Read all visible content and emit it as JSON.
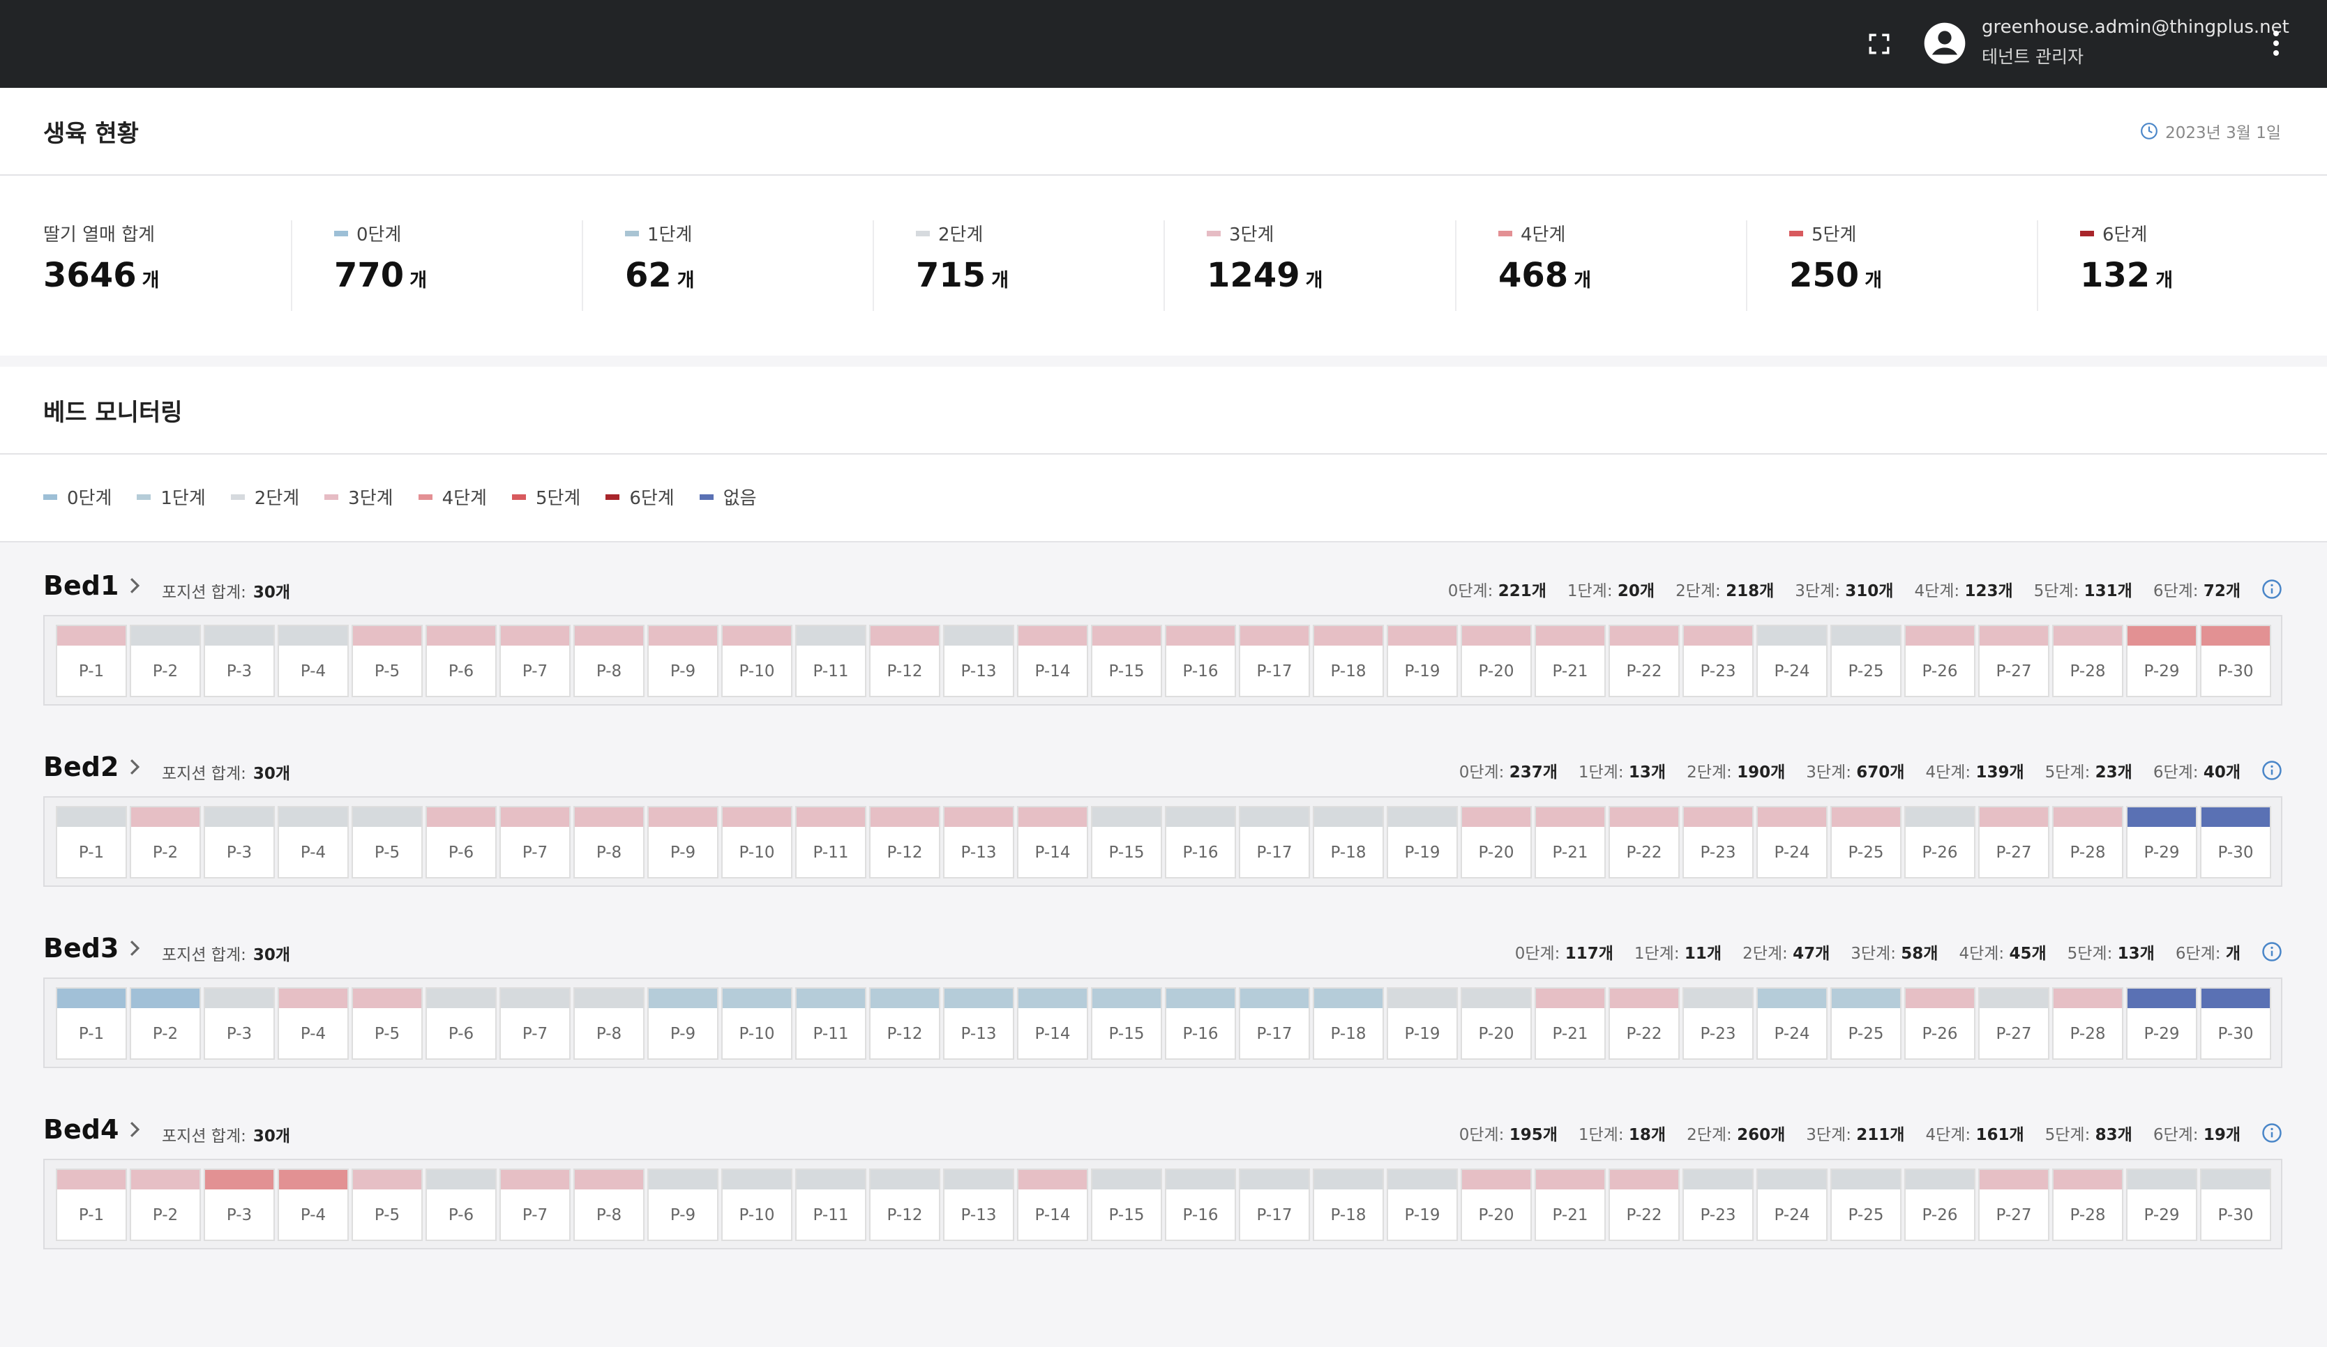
{
  "header": {
    "user_email": "greenhouse.admin@thingplus.net",
    "user_role": "테넌트 관리자",
    "icons": [
      "fullscreen-icon",
      "account-circle-icon",
      "more-vert-icon"
    ]
  },
  "growth": {
    "title": "생육 현황",
    "date": "2023년 3월 1일",
    "unit": "개",
    "stats": [
      {
        "label": "딸기 열매 합계",
        "value": "3646",
        "color": null
      },
      {
        "label": "0단계",
        "value": "770",
        "color": "#9dbfd6"
      },
      {
        "label": "1단계",
        "value": "62",
        "color": "#a9c4d3"
      },
      {
        "label": "2단계",
        "value": "715",
        "color": "#d6dade"
      },
      {
        "label": "3단계",
        "value": "1249",
        "color": "#e6bcc4"
      },
      {
        "label": "4단계",
        "value": "468",
        "color": "#e39094"
      },
      {
        "label": "5단계",
        "value": "250",
        "color": "#d85a5e"
      },
      {
        "label": "6단계",
        "value": "132",
        "color": "#a8252b"
      }
    ]
  },
  "bed_monitoring": {
    "title": "베드 모니터링",
    "legend": [
      {
        "label": "0단계",
        "color": "#9dbfd6"
      },
      {
        "label": "1단계",
        "color": "#b5ccd8"
      },
      {
        "label": "2단계",
        "color": "#d6dade"
      },
      {
        "label": "3단계",
        "color": "#e6bcc4"
      },
      {
        "label": "4단계",
        "color": "#e39094"
      },
      {
        "label": "5단계",
        "color": "#d85a5e"
      },
      {
        "label": "6단계",
        "color": "#a8252b"
      },
      {
        "label": "없음",
        "color": "#5a71b4"
      }
    ],
    "stage_colors": {
      "0": "#a1c0d7",
      "1": "#b5ccd9",
      "2": "#d6dadd",
      "3": "#e6bfc5",
      "4": "#e29193",
      "n": "#5a71b4"
    },
    "total_label": "포지션 합계:",
    "beds": [
      {
        "name": "Bed1",
        "total": "30개",
        "stats": [
          {
            "label": "0단계:",
            "value": "221개"
          },
          {
            "label": "1단계:",
            "value": "20개"
          },
          {
            "label": "2단계:",
            "value": "218개"
          },
          {
            "label": "3단계:",
            "value": "310개"
          },
          {
            "label": "4단계:",
            "value": "123개"
          },
          {
            "label": "5단계:",
            "value": "131개"
          },
          {
            "label": "6단계:",
            "value": "72개"
          }
        ],
        "slots": [
          "3",
          "2",
          "2",
          "2",
          "3",
          "3",
          "3",
          "3",
          "3",
          "3",
          "2",
          "3",
          "2",
          "3",
          "3",
          "3",
          "3",
          "3",
          "3",
          "3",
          "3",
          "3",
          "3",
          "2",
          "2",
          "3",
          "3",
          "3",
          "4",
          "4"
        ]
      },
      {
        "name": "Bed2",
        "total": "30개",
        "stats": [
          {
            "label": "0단계:",
            "value": "237개"
          },
          {
            "label": "1단계:",
            "value": "13개"
          },
          {
            "label": "2단계:",
            "value": "190개"
          },
          {
            "label": "3단계:",
            "value": "670개"
          },
          {
            "label": "4단계:",
            "value": "139개"
          },
          {
            "label": "5단계:",
            "value": "23개"
          },
          {
            "label": "6단계:",
            "value": "40개"
          }
        ],
        "slots": [
          "2",
          "3",
          "2",
          "2",
          "2",
          "3",
          "3",
          "3",
          "3",
          "3",
          "3",
          "3",
          "3",
          "3",
          "2",
          "2",
          "2",
          "2",
          "2",
          "3",
          "3",
          "3",
          "3",
          "3",
          "3",
          "2",
          "3",
          "3",
          "n",
          "n"
        ]
      },
      {
        "name": "Bed3",
        "total": "30개",
        "stats": [
          {
            "label": "0단계:",
            "value": "117개"
          },
          {
            "label": "1단계:",
            "value": "11개"
          },
          {
            "label": "2단계:",
            "value": "47개"
          },
          {
            "label": "3단계:",
            "value": "58개"
          },
          {
            "label": "4단계:",
            "value": "45개"
          },
          {
            "label": "5단계:",
            "value": "13개"
          },
          {
            "label": "6단계:",
            "value": "개"
          }
        ],
        "slots": [
          "0",
          "0",
          "2",
          "3",
          "3",
          "2",
          "2",
          "2",
          "1",
          "1",
          "1",
          "1",
          "1",
          "1",
          "1",
          "1",
          "1",
          "1",
          "2",
          "2",
          "3",
          "3",
          "2",
          "1",
          "1",
          "3",
          "2",
          "3",
          "n",
          "n"
        ]
      },
      {
        "name": "Bed4",
        "total": "30개",
        "stats": [
          {
            "label": "0단계:",
            "value": "195개"
          },
          {
            "label": "1단계:",
            "value": "18개"
          },
          {
            "label": "2단계:",
            "value": "260개"
          },
          {
            "label": "3단계:",
            "value": "211개"
          },
          {
            "label": "4단계:",
            "value": "161개"
          },
          {
            "label": "5단계:",
            "value": "83개"
          },
          {
            "label": "6단계:",
            "value": "19개"
          }
        ],
        "slots": [
          "3",
          "3",
          "4",
          "4",
          "3",
          "2",
          "3",
          "3",
          "2",
          "2",
          "2",
          "2",
          "2",
          "3",
          "2",
          "2",
          "2",
          "2",
          "2",
          "3",
          "3",
          "3",
          "2",
          "2",
          "2",
          "2",
          "3",
          "3",
          "2",
          "2"
        ]
      }
    ]
  }
}
